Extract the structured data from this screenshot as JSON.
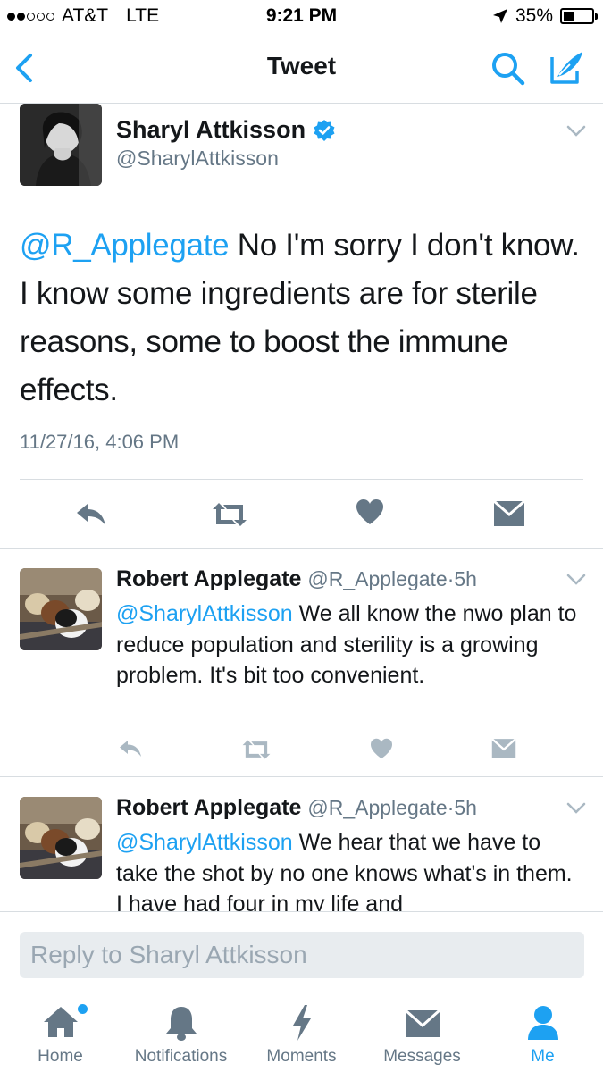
{
  "status_bar": {
    "carrier": "AT&T",
    "network": "LTE",
    "time": "9:21 PM",
    "battery_percent": "35%",
    "battery_level": 0.35
  },
  "nav": {
    "title": "Tweet",
    "back_icon": "chevron-left-icon",
    "search_icon": "search-icon",
    "compose_icon": "compose-icon"
  },
  "main_tweet": {
    "author_name": "Sharyl Attkisson",
    "author_handle": "@SharylAttkisson",
    "verified": true,
    "mention": "@R_Applegate",
    "text": " No I'm sorry I don't know. I know some ingredients are for sterile reasons, some to boost the immune effects.",
    "timestamp": "11/27/16, 4:06 PM"
  },
  "replies": [
    {
      "author_name": "Robert Applegate",
      "author_handle": "@R_Applegate",
      "separator": "·",
      "age": "5h",
      "mention": "@SharylAttkisson",
      "text": " We all know the nwo plan to reduce population and sterility is a growing problem.  It's bit too convenient."
    },
    {
      "author_name": "Robert Applegate",
      "author_handle": "@R_Applegate",
      "separator": "·",
      "age": "5h",
      "mention": "@SharylAttkisson",
      "text": " We hear that we have to take the shot by no one knows what's in them. I have had four in my life and"
    }
  ],
  "reply_bar": {
    "placeholder": "Reply to Sharyl Attkisson"
  },
  "tabs": [
    {
      "label": "Home",
      "icon": "home-icon",
      "has_badge": true
    },
    {
      "label": "Notifications",
      "icon": "bell-icon"
    },
    {
      "label": "Moments",
      "icon": "lightning-icon"
    },
    {
      "label": "Messages",
      "icon": "envelope-icon"
    },
    {
      "label": "Me",
      "icon": "person-icon",
      "active": true
    }
  ],
  "colors": {
    "accent": "#1da1f2",
    "icon_gray": "#657786",
    "reply_icon_gray": "#aab8c2",
    "text": "#14171a",
    "divider": "#d8dde1"
  }
}
